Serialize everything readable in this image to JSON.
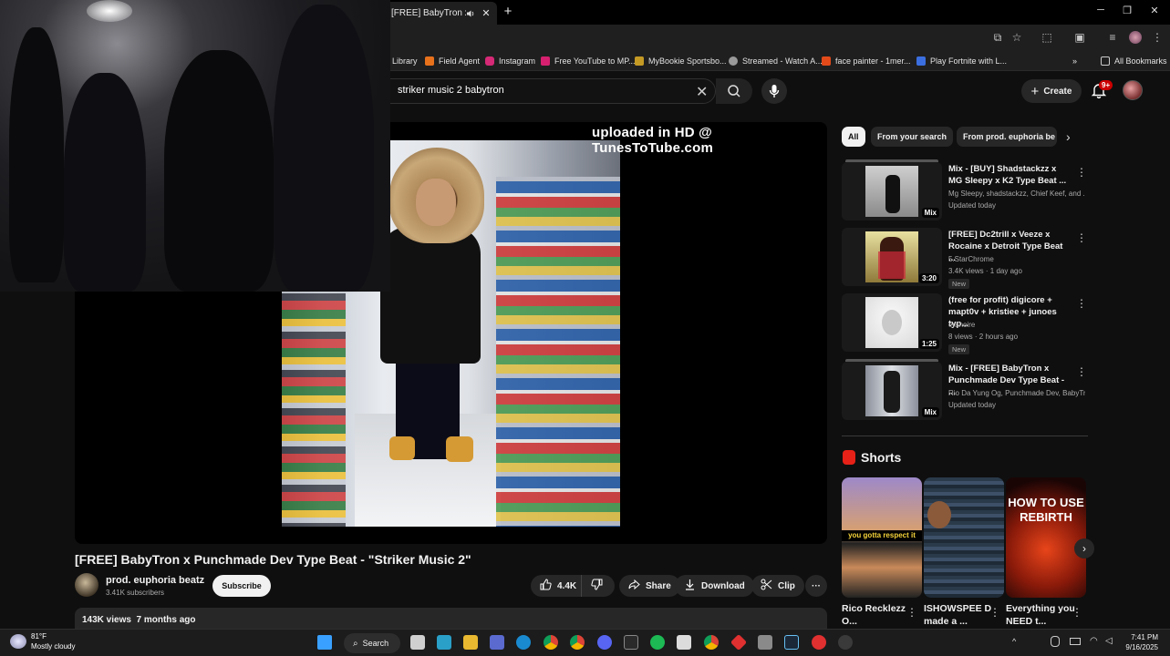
{
  "browser": {
    "tab_title": "[FREE] BabyTron x Pun",
    "new_tab": "+",
    "window_controls": [
      "─",
      "❐",
      "✕"
    ],
    "bookmarks": [
      {
        "label": "Library",
        "color": "#1f1f1f"
      },
      {
        "label": "Field Agent",
        "color": "#e8711c"
      },
      {
        "label": "Instagram",
        "color": "#d62976"
      },
      {
        "label": "Free YouTube to MP...",
        "color": "#d6206f"
      },
      {
        "label": "MyBookie Sportsbo...",
        "color": "#c49a25"
      },
      {
        "label": "Streamed - Watch A...",
        "color": "#9a9a9a"
      },
      {
        "label": "face painter - 1mer...",
        "color": "#e34a1a"
      },
      {
        "label": "Play Fortnite with L...",
        "color": "#3b6fe0"
      }
    ],
    "bookmarks_overflow": "»",
    "all_bookmarks": "All Bookmarks"
  },
  "header": {
    "search_value": "striker music 2 babytron",
    "create_label": "Create",
    "notifications_badge": "9+"
  },
  "player": {
    "watermark": "uploaded in HD @ TunesToTube.com"
  },
  "video": {
    "title": "[FREE] BabyTron x Punchmade Dev Type Beat - \"Striker Music 2\"",
    "channel_name": "prod. euphoria beatz",
    "subscribers": "3.41K subscribers",
    "subscribe_label": "Subscribe",
    "likes": "4.4K",
    "share_label": "Share",
    "download_label": "Download",
    "clip_label": "Clip",
    "more": "···",
    "views": "143K views",
    "age": "7 months ago"
  },
  "chips": [
    {
      "label": "All",
      "active": true
    },
    {
      "label": "From your search",
      "active": false
    },
    {
      "label": "From prod. euphoria be",
      "active": false
    }
  ],
  "recommendations": [
    {
      "title": "Mix - [BUY] Shadstackzz x MG Sleepy x K2 Type Beat ...",
      "channel": "Mg Sleepy, shadstackzz, Chief Keef, and ...",
      "meta": "Updated today",
      "badge": "Mix",
      "new": ""
    },
    {
      "title": "[FREE] Dc2trill x Veeze x Rocaine x Detroit Type Beat ...",
      "channel": "5.StarChrome",
      "meta": "3.4K views · 1 day ago",
      "badge": "3:20",
      "new": "New"
    },
    {
      "title": "(free for profit) digicore + mapt0v + kristiee + junoes typ...",
      "channel": "eranoire",
      "meta": "8 views · 2 hours ago",
      "badge": "1:25",
      "new": "New"
    },
    {
      "title": "Mix - [FREE] BabyTron x Punchmade Dev Type Beat - ...",
      "channel": "Rio Da Yung Og, Punchmade Dev, BabyTr...",
      "meta": "Updated today",
      "badge": "Mix",
      "new": ""
    }
  ],
  "shorts": {
    "heading": "Shorts",
    "items": [
      {
        "title": "Rico Recklezz O...",
        "overlay": "you gotta respect it"
      },
      {
        "title": "ISHOWSPEE D made a ...",
        "overlay": ""
      },
      {
        "title": "Everything you NEED t...",
        "overlay": "HOW TO USE REBIRTH"
      }
    ]
  },
  "taskbar": {
    "temperature": "81°F",
    "weather": "Mostly cloudy",
    "search_label": "Search",
    "time": "7:41 PM",
    "date": "9/16/2025"
  }
}
